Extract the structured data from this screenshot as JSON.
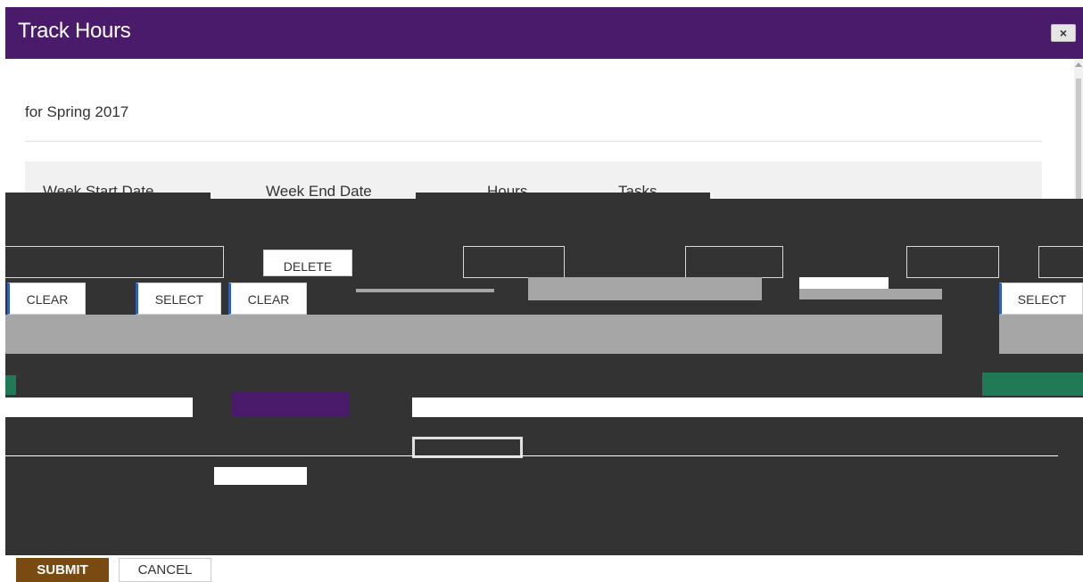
{
  "dialog": {
    "title": "Track Hours",
    "close_label": "×",
    "subtitle": "for Spring 2017"
  },
  "table": {
    "columns": [
      "Week Start Date",
      "Week End Date",
      "Hours",
      "Tasks"
    ]
  },
  "buttons": {
    "clear_1": "CLEAR",
    "select_1": "SELECT",
    "clear_2": "CLEAR",
    "delete": "DELETE",
    "select_2": "SELECT"
  },
  "footer": {
    "submit_label": "SUBMIT",
    "cancel_label": "CANCEL"
  },
  "colors": {
    "header": "#4a1a6b",
    "submit": "#7a4a13",
    "accent_green": "#1f7a55",
    "accent_blue": "#2d5fbf"
  }
}
